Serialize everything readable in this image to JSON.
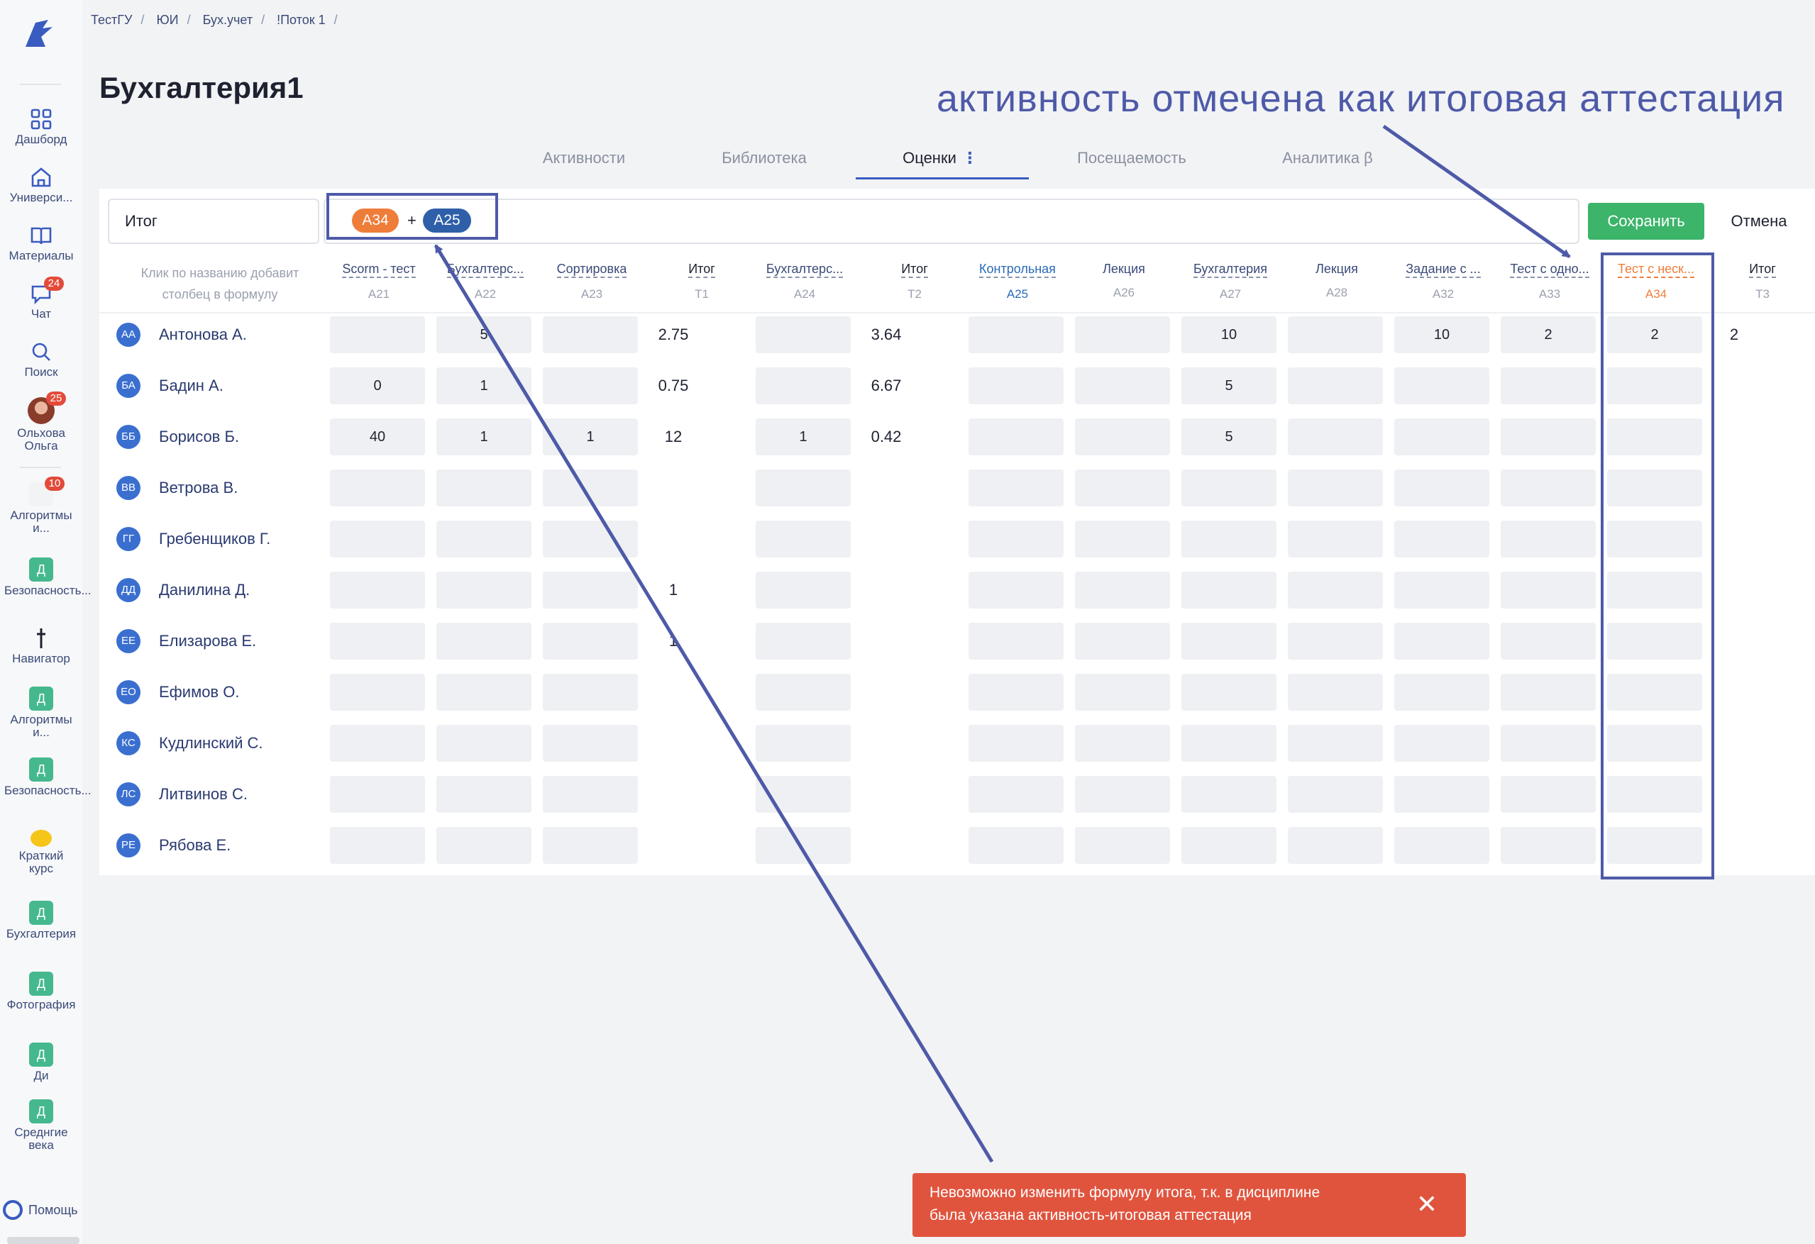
{
  "breadcrumbs": [
    "ТестГУ",
    "ЮИ",
    "Бух.учет",
    "!Поток 1"
  ],
  "page_title": "Бухгалтерия1",
  "annotation_text": "активность отмечена как итоговая аттестация",
  "tabs": [
    "Активности",
    "Библиотека",
    "Оценки",
    "Посещаемость",
    "Аналитика β"
  ],
  "active_tab": "Оценки",
  "sidebar": {
    "items": [
      {
        "label": "Дашборд",
        "icon": "grid-icon"
      },
      {
        "label": "Универси...",
        "icon": "university-icon"
      },
      {
        "label": "Материалы",
        "icon": "book-icon"
      },
      {
        "label": "Чат",
        "icon": "chat-icon",
        "badge": "24"
      },
      {
        "label": "Поиск",
        "icon": "search-icon"
      },
      {
        "label": "Ольхова Ольга",
        "icon": "avatar",
        "badge": "25"
      }
    ],
    "courses": [
      {
        "label": "Алгоритмы и...",
        "letter": "",
        "badge": "10"
      },
      {
        "label": "Безопасность...",
        "letter": "Д"
      },
      {
        "label": "Навигатор",
        "letter": ""
      },
      {
        "label": "Алгоритмы и...",
        "letter": "Д"
      },
      {
        "label": "Безопасность...",
        "letter": "Д"
      },
      {
        "label": "Краткий курс",
        "letter": ""
      },
      {
        "label": "Бухгалтерия",
        "letter": "Д"
      },
      {
        "label": "Фотография",
        "letter": "Д"
      },
      {
        "label": "Ди",
        "letter": "Д"
      },
      {
        "label": "Среднгие века",
        "letter": "Д"
      }
    ],
    "help_label": "Помощь"
  },
  "formula": {
    "name_value": "Итог",
    "chip1": "A34",
    "plus": "+",
    "chip2": "A25",
    "save_label": "Сохранить",
    "cancel_label": "Отмена"
  },
  "hint": "Клик по названию добавит столбец в формулу",
  "columns": [
    {
      "name": "Scorm - тест",
      "code": "A21"
    },
    {
      "name": "Бухгалтерс...",
      "code": "A22"
    },
    {
      "name": "Сортировка",
      "code": "A23"
    },
    {
      "name": "Итог",
      "code": "T1"
    },
    {
      "name": "Бухгалтерс...",
      "code": "A24"
    },
    {
      "name": "Итог",
      "code": "T2"
    },
    {
      "name": "Контрольная",
      "code": "A25"
    },
    {
      "name": "Лекция",
      "code": "A26"
    },
    {
      "name": "Бухгалтерия",
      "code": "A27"
    },
    {
      "name": "Лекция",
      "code": "A28"
    },
    {
      "name": "Задание с ...",
      "code": "A32"
    },
    {
      "name": "Тест с одно...",
      "code": "A33"
    },
    {
      "name": "Тест с неск...",
      "code": "A34"
    },
    {
      "name": "Итог",
      "code": "T3"
    }
  ],
  "students": [
    {
      "initials": "АА",
      "name": "Антонова А.",
      "values": [
        "",
        "5",
        "",
        "2.75",
        "",
        "3.64",
        "",
        "",
        "10",
        "",
        "10",
        "2",
        "2",
        "2"
      ]
    },
    {
      "initials": "БА",
      "name": "Бадин А.",
      "values": [
        "0",
        "1",
        "",
        "0.75",
        "",
        "6.67",
        "",
        "",
        "5",
        "",
        "",
        "",
        "",
        ""
      ]
    },
    {
      "initials": "ББ",
      "name": "Борисов Б.",
      "values": [
        "40",
        "1",
        "1",
        "12",
        "1",
        "0.42",
        "",
        "",
        "5",
        "",
        "",
        "",
        "",
        ""
      ]
    },
    {
      "initials": "ВВ",
      "name": "Ветрова В.",
      "values": [
        "",
        "",
        "",
        "",
        "",
        "",
        "",
        "",
        "",
        "",
        "",
        "",
        "",
        ""
      ]
    },
    {
      "initials": "ГГ",
      "name": "Гребенщиков Г.",
      "values": [
        "",
        "",
        "",
        "",
        "",
        "",
        "",
        "",
        "",
        "",
        "",
        "",
        "",
        ""
      ]
    },
    {
      "initials": "ДД",
      "name": "Данилина Д.",
      "values": [
        "",
        "",
        "",
        "1",
        "",
        "",
        "",
        "",
        "",
        "",
        "",
        "",
        "",
        ""
      ]
    },
    {
      "initials": "ЕЕ",
      "name": "Елизарова Е.",
      "values": [
        "",
        "",
        "",
        "1",
        "",
        "",
        "",
        "",
        "",
        "",
        "",
        "",
        "",
        ""
      ]
    },
    {
      "initials": "ЕО",
      "name": "Ефимов О.",
      "values": [
        "",
        "",
        "",
        "",
        "",
        "",
        "",
        "",
        "",
        "",
        "",
        "",
        "",
        ""
      ]
    },
    {
      "initials": "КС",
      "name": "Кудлинский С.",
      "values": [
        "",
        "",
        "",
        "",
        "",
        "",
        "",
        "",
        "",
        "",
        "",
        "",
        "",
        ""
      ]
    },
    {
      "initials": "ЛС",
      "name": "Литвинов С.",
      "values": [
        "",
        "",
        "",
        "",
        "",
        "",
        "",
        "",
        "",
        "",
        "",
        "",
        "",
        ""
      ]
    },
    {
      "initials": "РЕ",
      "name": "Рябова Е.",
      "values": [
        "",
        "",
        "",
        "",
        "",
        "",
        "",
        "",
        "",
        "",
        "",
        "",
        "",
        ""
      ]
    }
  ],
  "toast": {
    "line1": "Невозможно изменить формулу итога, т.к. в дисциплине",
    "line2": "была указана активность-итоговая аттестация",
    "close": "✕"
  },
  "colors": {
    "accent": "#3a5bbf",
    "save": "#3cb46a",
    "toast": "#e0543e",
    "annotation": "#4e5aa8",
    "chip_orange": "#ef7d3a",
    "chip_blue": "#2f5fa8"
  }
}
